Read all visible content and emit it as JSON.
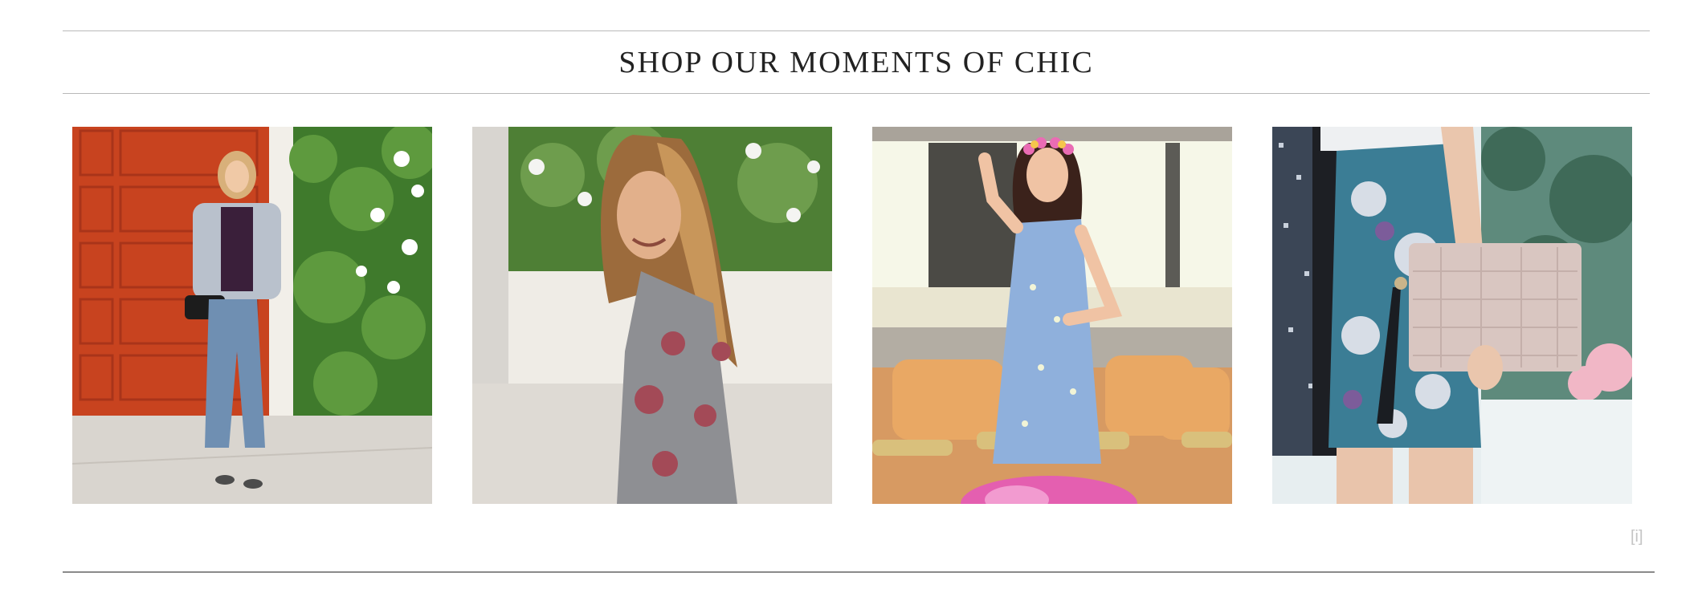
{
  "section": {
    "title": "SHOP OUR MOMENTS OF CHIC",
    "info_link": "[i]"
  },
  "photos": [
    {
      "subject": "woman in tweed jacket and ripped jeans by orange door"
    },
    {
      "subject": "woman with long wavy hair in grey floral sweater"
    },
    {
      "subject": "woman with flower crown in blue printed dress"
    },
    {
      "subject": "floral skirt with blush croc clutch"
    }
  ],
  "colors": {
    "rule": "#b9b9b9",
    "heading": "#222222",
    "info": "#c4c4c4"
  }
}
